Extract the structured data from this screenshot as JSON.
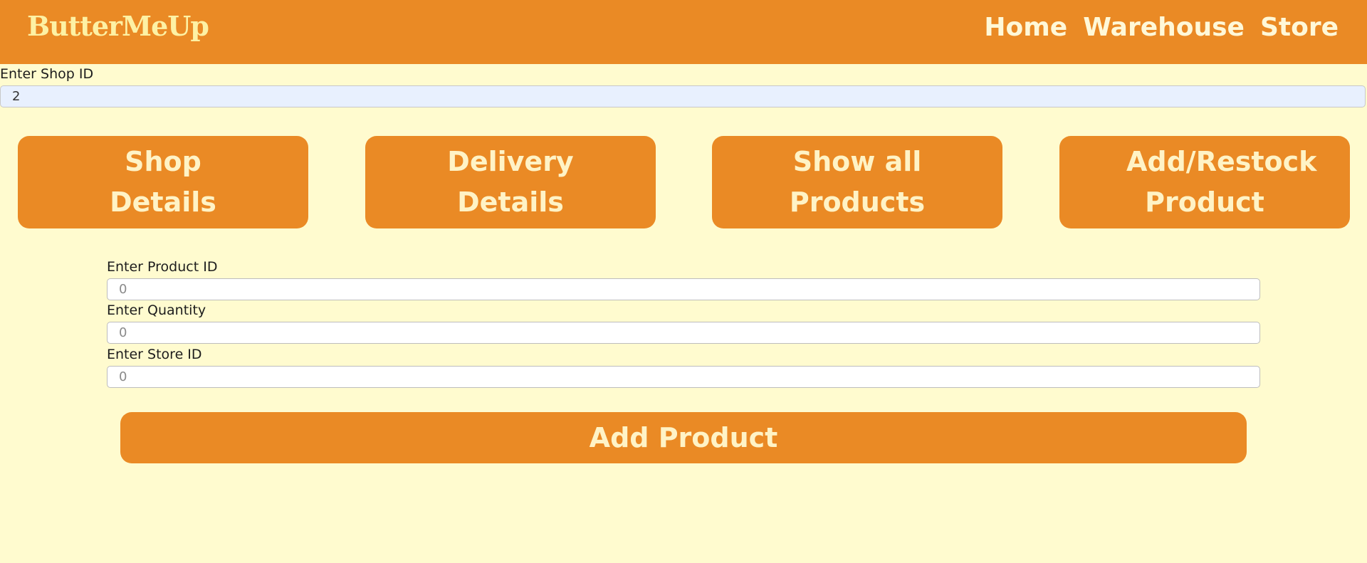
{
  "navbar": {
    "brand": "ButterMeUp",
    "links": [
      "Home",
      "Warehouse",
      "Store"
    ],
    "bg_color": "#ea8a25"
  },
  "shop": {
    "label": "Enter Shop ID",
    "value": "2"
  },
  "actions": [
    {
      "label": "Shop Details"
    },
    {
      "label": "Delivery Details"
    },
    {
      "label": "Show all Products"
    },
    {
      "label": "Add/Restock Product"
    }
  ],
  "form": {
    "product_id": {
      "label": "Enter Product ID",
      "placeholder": "0"
    },
    "quantity": {
      "label": "Enter Quantity",
      "placeholder": "0"
    },
    "store_id": {
      "label": "Enter Store ID",
      "placeholder": "0"
    },
    "submit_label": "Add Product"
  },
  "colors": {
    "accent": "#ea8a25",
    "background": "#fffbcf",
    "button_text": "#fff3c6"
  }
}
